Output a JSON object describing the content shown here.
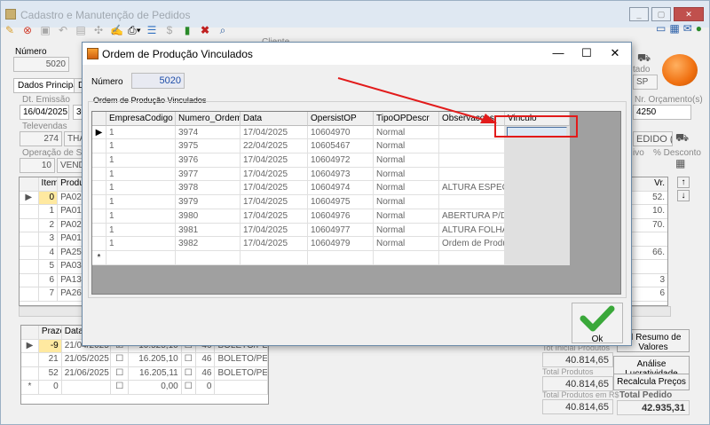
{
  "main": {
    "title": "Cadastro e Manutenção de Pedidos",
    "toolbar_icons": [
      "pencil-icon",
      "cancel-icon",
      "save-icon",
      "undo-icon",
      "print-icon",
      "tools-icon",
      "edit-icon",
      "printer-dropdown-icon",
      "list-icon",
      "dollar-icon",
      "export-icon",
      "delete-icon",
      "search-doc-icon"
    ],
    "numero_label": "Número",
    "numero_value": "5020",
    "cliente_label": "Cliente",
    "tabs": [
      "Dados Principais",
      "Da"
    ],
    "dt_emissao_label": "Dt. Emissão",
    "dt_emissao_value": "16/04/2025",
    "dt_second_value": "30",
    "televendas_label": "Televendas",
    "televendas_value": "274",
    "televendas_name": "THA",
    "operacao_label": "Operação de Saída",
    "operacao_value": "10",
    "operacao_name": "VEND",
    "estado_label": "tado",
    "estado_value": "SP",
    "nr_orcamento_label": "Nr. Orçamento(s)",
    "nr_orcamento_value": "4250",
    "pedido_value": "EDIDO (3",
    "ativo_label": "ivo",
    "desconto_label": "% Desconto",
    "items_header": [
      "Item",
      "Produto"
    ],
    "items": [
      {
        "item": "0",
        "prod": "PA0287"
      },
      {
        "item": "1",
        "prod": "PA0193"
      },
      {
        "item": "2",
        "prod": "PA0272"
      },
      {
        "item": "3",
        "prod": "PA0165"
      },
      {
        "item": "4",
        "prod": "PA2597"
      },
      {
        "item": "5",
        "prod": "PA0341"
      },
      {
        "item": "6",
        "prod": "PA1380"
      },
      {
        "item": "7",
        "prod": "PA2663"
      }
    ],
    "right_col_header": "Vr.",
    "right_col_values": [
      "52.",
      "10.",
      "70.",
      "",
      "66.",
      "",
      "3",
      "6"
    ],
    "prazo_header": [
      "Prazo",
      "Data"
    ],
    "prazos": [
      {
        "prazo": "-9",
        "data": "21/04/2025",
        "checked": true,
        "valor": "10.525,10",
        "n": "46",
        "desc": "BOLETO/PE..."
      },
      {
        "prazo": "21",
        "data": "21/05/2025",
        "checked": false,
        "valor": "16.205,10",
        "n": "46",
        "desc": "BOLETO/PE..."
      },
      {
        "prazo": "52",
        "data": "21/06/2025",
        "checked": false,
        "valor": "16.205,11",
        "n": "46",
        "desc": "BOLETO/PE..."
      },
      {
        "prazo": "0",
        "data": "",
        "checked": false,
        "valor": "0,00",
        "n": "0",
        "desc": ""
      }
    ],
    "resumo_button": "Resumo de Valores",
    "analise_button": "Análise Lucratividade",
    "recalcula_button": "Recalcula Preços",
    "tot_inicial_label": "Tot Inicial Produtos",
    "tot_inicial_value": "40.814,65",
    "total_produtos_label": "Total Produtos",
    "total_produtos_value": "40.814,65",
    "total_produtos_rs_label": "Total Produtos em R$",
    "total_produtos_rs_value": "40.814,65",
    "total_pedido_label": "Total Pedido",
    "total_pedido_value": "42.935,31"
  },
  "dialog": {
    "title": "Ordem de Produção Vinculados",
    "numero_label": "Número",
    "numero_value": "5020",
    "group_label": "Ordem de Produção Vinculados",
    "columns": [
      "EmpresaCodigo",
      "Numero_OrdemPro",
      "Data",
      "OpersistOP",
      "TipoOPDescr",
      "Observacoes",
      "Vinculo"
    ],
    "rows": [
      {
        "empresa": "1",
        "numero": "3974",
        "data": "17/04/2025",
        "opersist": "10604970",
        "tipo": "Normal",
        "obs": ""
      },
      {
        "empresa": "1",
        "numero": "3975",
        "data": "22/04/2025",
        "opersist": "10605467",
        "tipo": "Normal",
        "obs": ""
      },
      {
        "empresa": "1",
        "numero": "3976",
        "data": "17/04/2025",
        "opersist": "10604972",
        "tipo": "Normal",
        "obs": ""
      },
      {
        "empresa": "1",
        "numero": "3977",
        "data": "17/04/2025",
        "opersist": "10604973",
        "tipo": "Normal",
        "obs": ""
      },
      {
        "empresa": "1",
        "numero": "3978",
        "data": "17/04/2025",
        "opersist": "10604974",
        "tipo": "Normal",
        "obs": "ALTURA ESPEC..."
      },
      {
        "empresa": "1",
        "numero": "3979",
        "data": "17/04/2025",
        "opersist": "10604975",
        "tipo": "Normal",
        "obs": ""
      },
      {
        "empresa": "1",
        "numero": "3980",
        "data": "17/04/2025",
        "opersist": "10604976",
        "tipo": "Normal",
        "obs": "ABERTURA P/D..."
      },
      {
        "empresa": "1",
        "numero": "3981",
        "data": "17/04/2025",
        "opersist": "10604977",
        "tipo": "Normal",
        "obs": "ALTURA FOLHA..."
      },
      {
        "empresa": "1",
        "numero": "3982",
        "data": "17/04/2025",
        "opersist": "10604979",
        "tipo": "Normal",
        "obs": "Ordem de Produç..."
      }
    ],
    "ok_label": "Ok",
    "minimize": "—",
    "maximize": "☐",
    "close": "✕"
  },
  "colors": {
    "annotation": "#e21b1b",
    "accent": "#1f4ea8",
    "ok_check": "#3aa83a"
  }
}
